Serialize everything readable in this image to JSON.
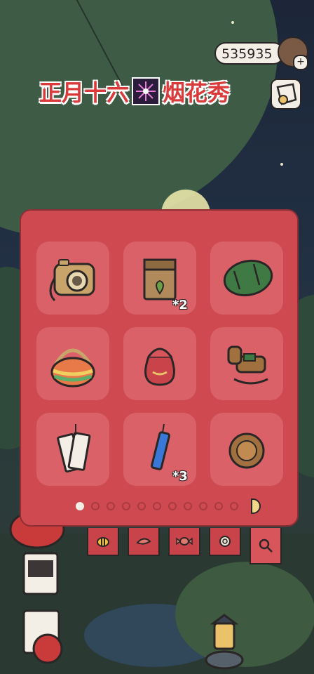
{
  "currency": {
    "amount": "535935",
    "icon": "acorn-icon",
    "add_icon": "plus-icon"
  },
  "banner": {
    "text_left": "正月十六",
    "text_right": "烟花秀",
    "icon": "fireworks-icon"
  },
  "inventory": {
    "items": [
      {
        "name": "instant-camera",
        "qty": ""
      },
      {
        "name": "seed-pouch",
        "qty": "*2"
      },
      {
        "name": "sleeping-bag",
        "qty": ""
      },
      {
        "name": "rainbow-basket",
        "qty": ""
      },
      {
        "name": "drawstring-pouch",
        "qty": ""
      },
      {
        "name": "wooden-toy-horse",
        "qty": ""
      },
      {
        "name": "paper-charm-tags",
        "qty": ""
      },
      {
        "name": "firework-stick",
        "qty": "*3"
      },
      {
        "name": "wooden-coin",
        "qty": ""
      }
    ],
    "page_dots": 11,
    "active_page": 0
  },
  "tabs": [
    {
      "icon": "bee-icon"
    },
    {
      "icon": "leaf-icon"
    },
    {
      "icon": "candy-icon"
    },
    {
      "icon": "snail-icon"
    },
    {
      "icon": "magnifier-icon"
    }
  ],
  "colors": {
    "panel": "#cf4a50",
    "slot": "#d96167",
    "banner": "#d93a3a"
  }
}
